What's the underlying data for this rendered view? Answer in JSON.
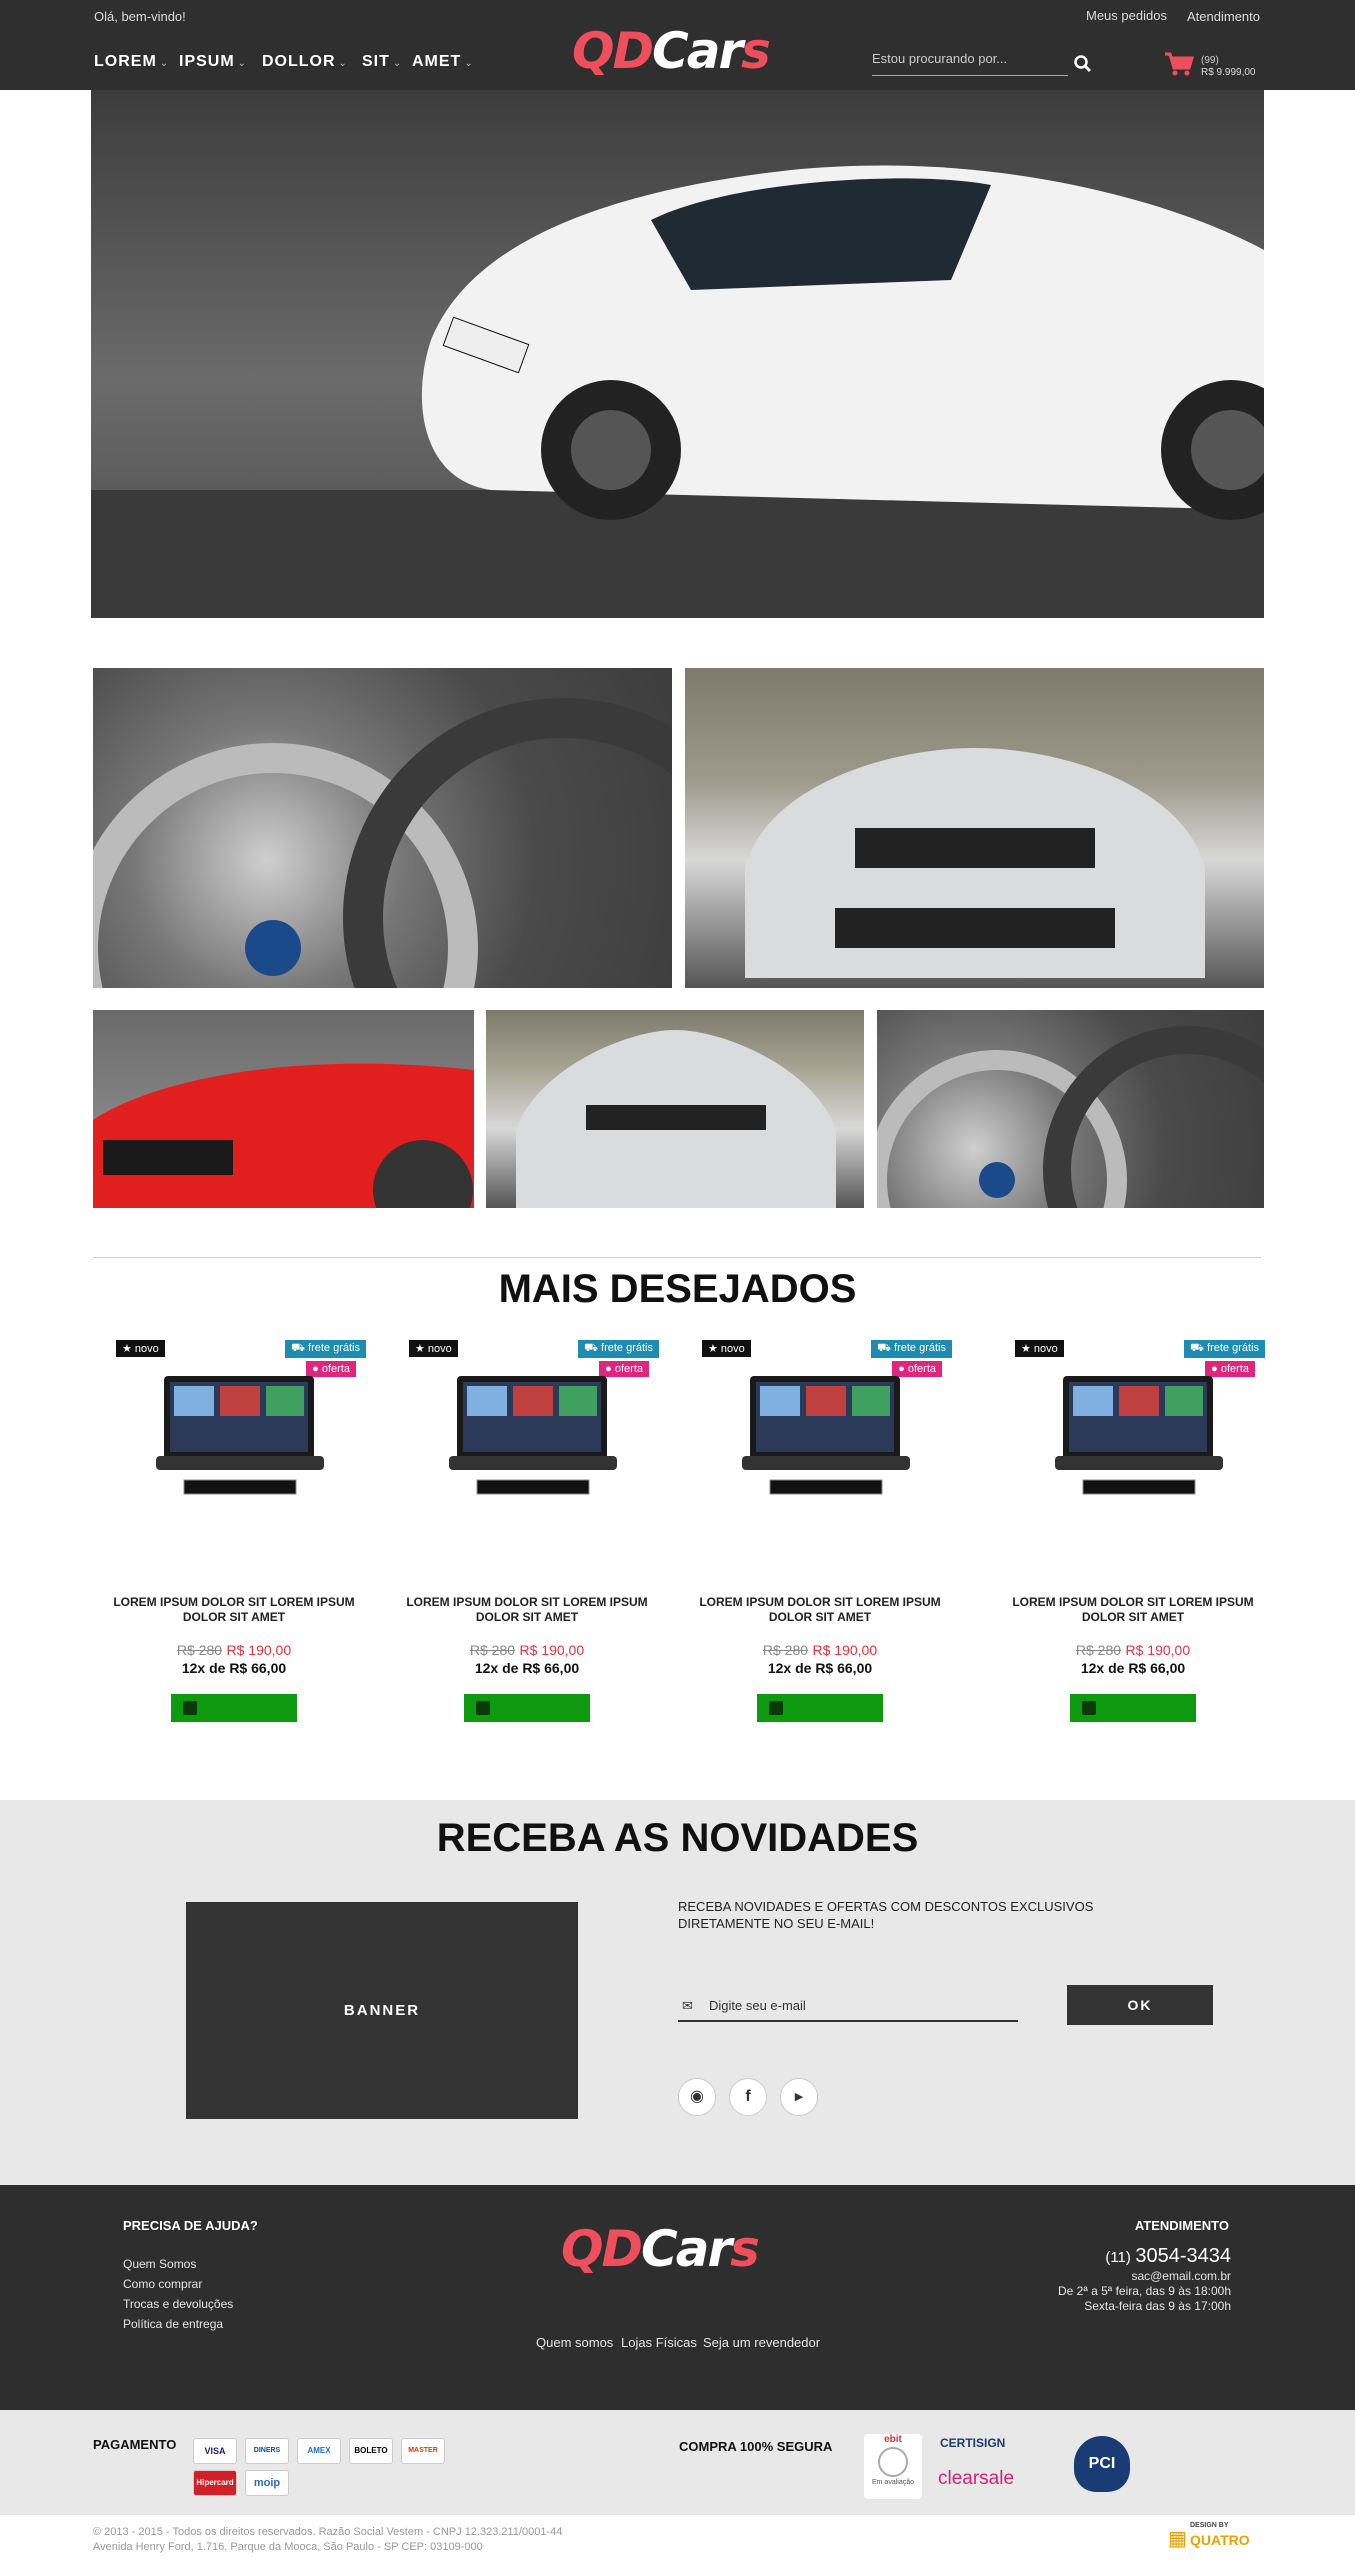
{
  "header": {
    "welcome": "Olá, bem-vindo!",
    "links": [
      "Meus pedidos",
      "Atendimento"
    ],
    "nav": [
      {
        "label": "LOREM"
      },
      {
        "label": "IPSUM"
      },
      {
        "label": "DOLLOR"
      },
      {
        "label": "SIT"
      },
      {
        "label": "AMET"
      }
    ],
    "logo_part1": "QD",
    "logo_part2": "Car",
    "logo_part3": "s",
    "search_placeholder": "Estou procurando por...",
    "cart_count": "(99)",
    "cart_total": "R$ 9.999,00",
    "colors": {
      "brand": "#ef4f5d",
      "bar": "#2f2f2f"
    }
  },
  "section_title": "MAIS DESEJADOS",
  "products": [
    {
      "badge_novo": "novo",
      "badge_frete": "frete grátis",
      "badge_oferta": "oferta",
      "name": "LOREM IPSUM DOLOR SIT LOREM IPSUM DOLOR SIT AMET",
      "old_price": "R$ 280",
      "new_price": "R$ 190,00",
      "installments": "12x de  R$ 66,00"
    },
    {
      "badge_novo": "novo",
      "badge_frete": "frete grátis",
      "badge_oferta": "oferta",
      "name": "LOREM IPSUM DOLOR SIT LOREM IPSUM DOLOR SIT AMET",
      "old_price": "R$ 280",
      "new_price": "R$ 190,00",
      "installments": "12x de  R$ 66,00"
    },
    {
      "badge_novo": "novo",
      "badge_frete": "frete grátis",
      "badge_oferta": "oferta",
      "name": "LOREM IPSUM DOLOR SIT LOREM IPSUM DOLOR SIT AMET",
      "old_price": "R$ 280",
      "new_price": "R$ 190,00",
      "installments": "12x de  R$ 66,00"
    },
    {
      "badge_novo": "novo",
      "badge_frete": "frete grátis",
      "badge_oferta": "oferta",
      "name": "LOREM IPSUM DOLOR SIT LOREM IPSUM DOLOR SIT AMET",
      "old_price": "R$ 280",
      "new_price": "R$ 190,00",
      "installments": "12x de  R$ 66,00"
    }
  ],
  "newsletter": {
    "title": "RECEBA AS NOVIDADES",
    "banner": "BANNER",
    "text": "RECEBA NOVIDADES E OFERTAS COM DESCONTOS EXCLUSIVOS DIRETAMENTE NO SEU E-MAIL!",
    "placeholder": "Digite seu e-mail",
    "button": "OK"
  },
  "footer": {
    "help_title": "PRECISA DE AJUDA?",
    "help_links": [
      "Quem Somos",
      "Como comprar",
      "Trocas e devoluções",
      "Política de entrega"
    ],
    "center_links": [
      "Quem somos",
      "Lojas Físicas",
      "Seja um revendedor"
    ],
    "service_title": "ATENDIMENTO",
    "phone_ddd": "(11)",
    "phone": "3054-3434",
    "email": "sac@email.com.br",
    "hours1": "De 2ª a 5ª feira, das 9 às 18:00h",
    "hours2": "Sexta-feira das 9 às 17:00h"
  },
  "payment": {
    "title": "PAGAMENTO",
    "cards": [
      "VISA",
      "DINERS",
      "AMEX",
      "BOLETO",
      "MASTER",
      "Hipercard",
      "moip"
    ],
    "secure_title": "COMPRA 100% SEGURA",
    "seals": [
      "ebit",
      "Em avaliação",
      "CERTISIGN",
      "clearsale",
      "PCI"
    ]
  },
  "legal": {
    "line1": "© 2013 - 2015 - Todos os direitos reservados. Razão Social Vestem - CNPJ 12.323.211/0001-44",
    "line2": "Avenida Henry Ford, 1.716, Parque da Mooca, São Paulo - SP CEP: 03109-000",
    "designer": "QUATRO",
    "designer_small": "DESIGN BY"
  }
}
